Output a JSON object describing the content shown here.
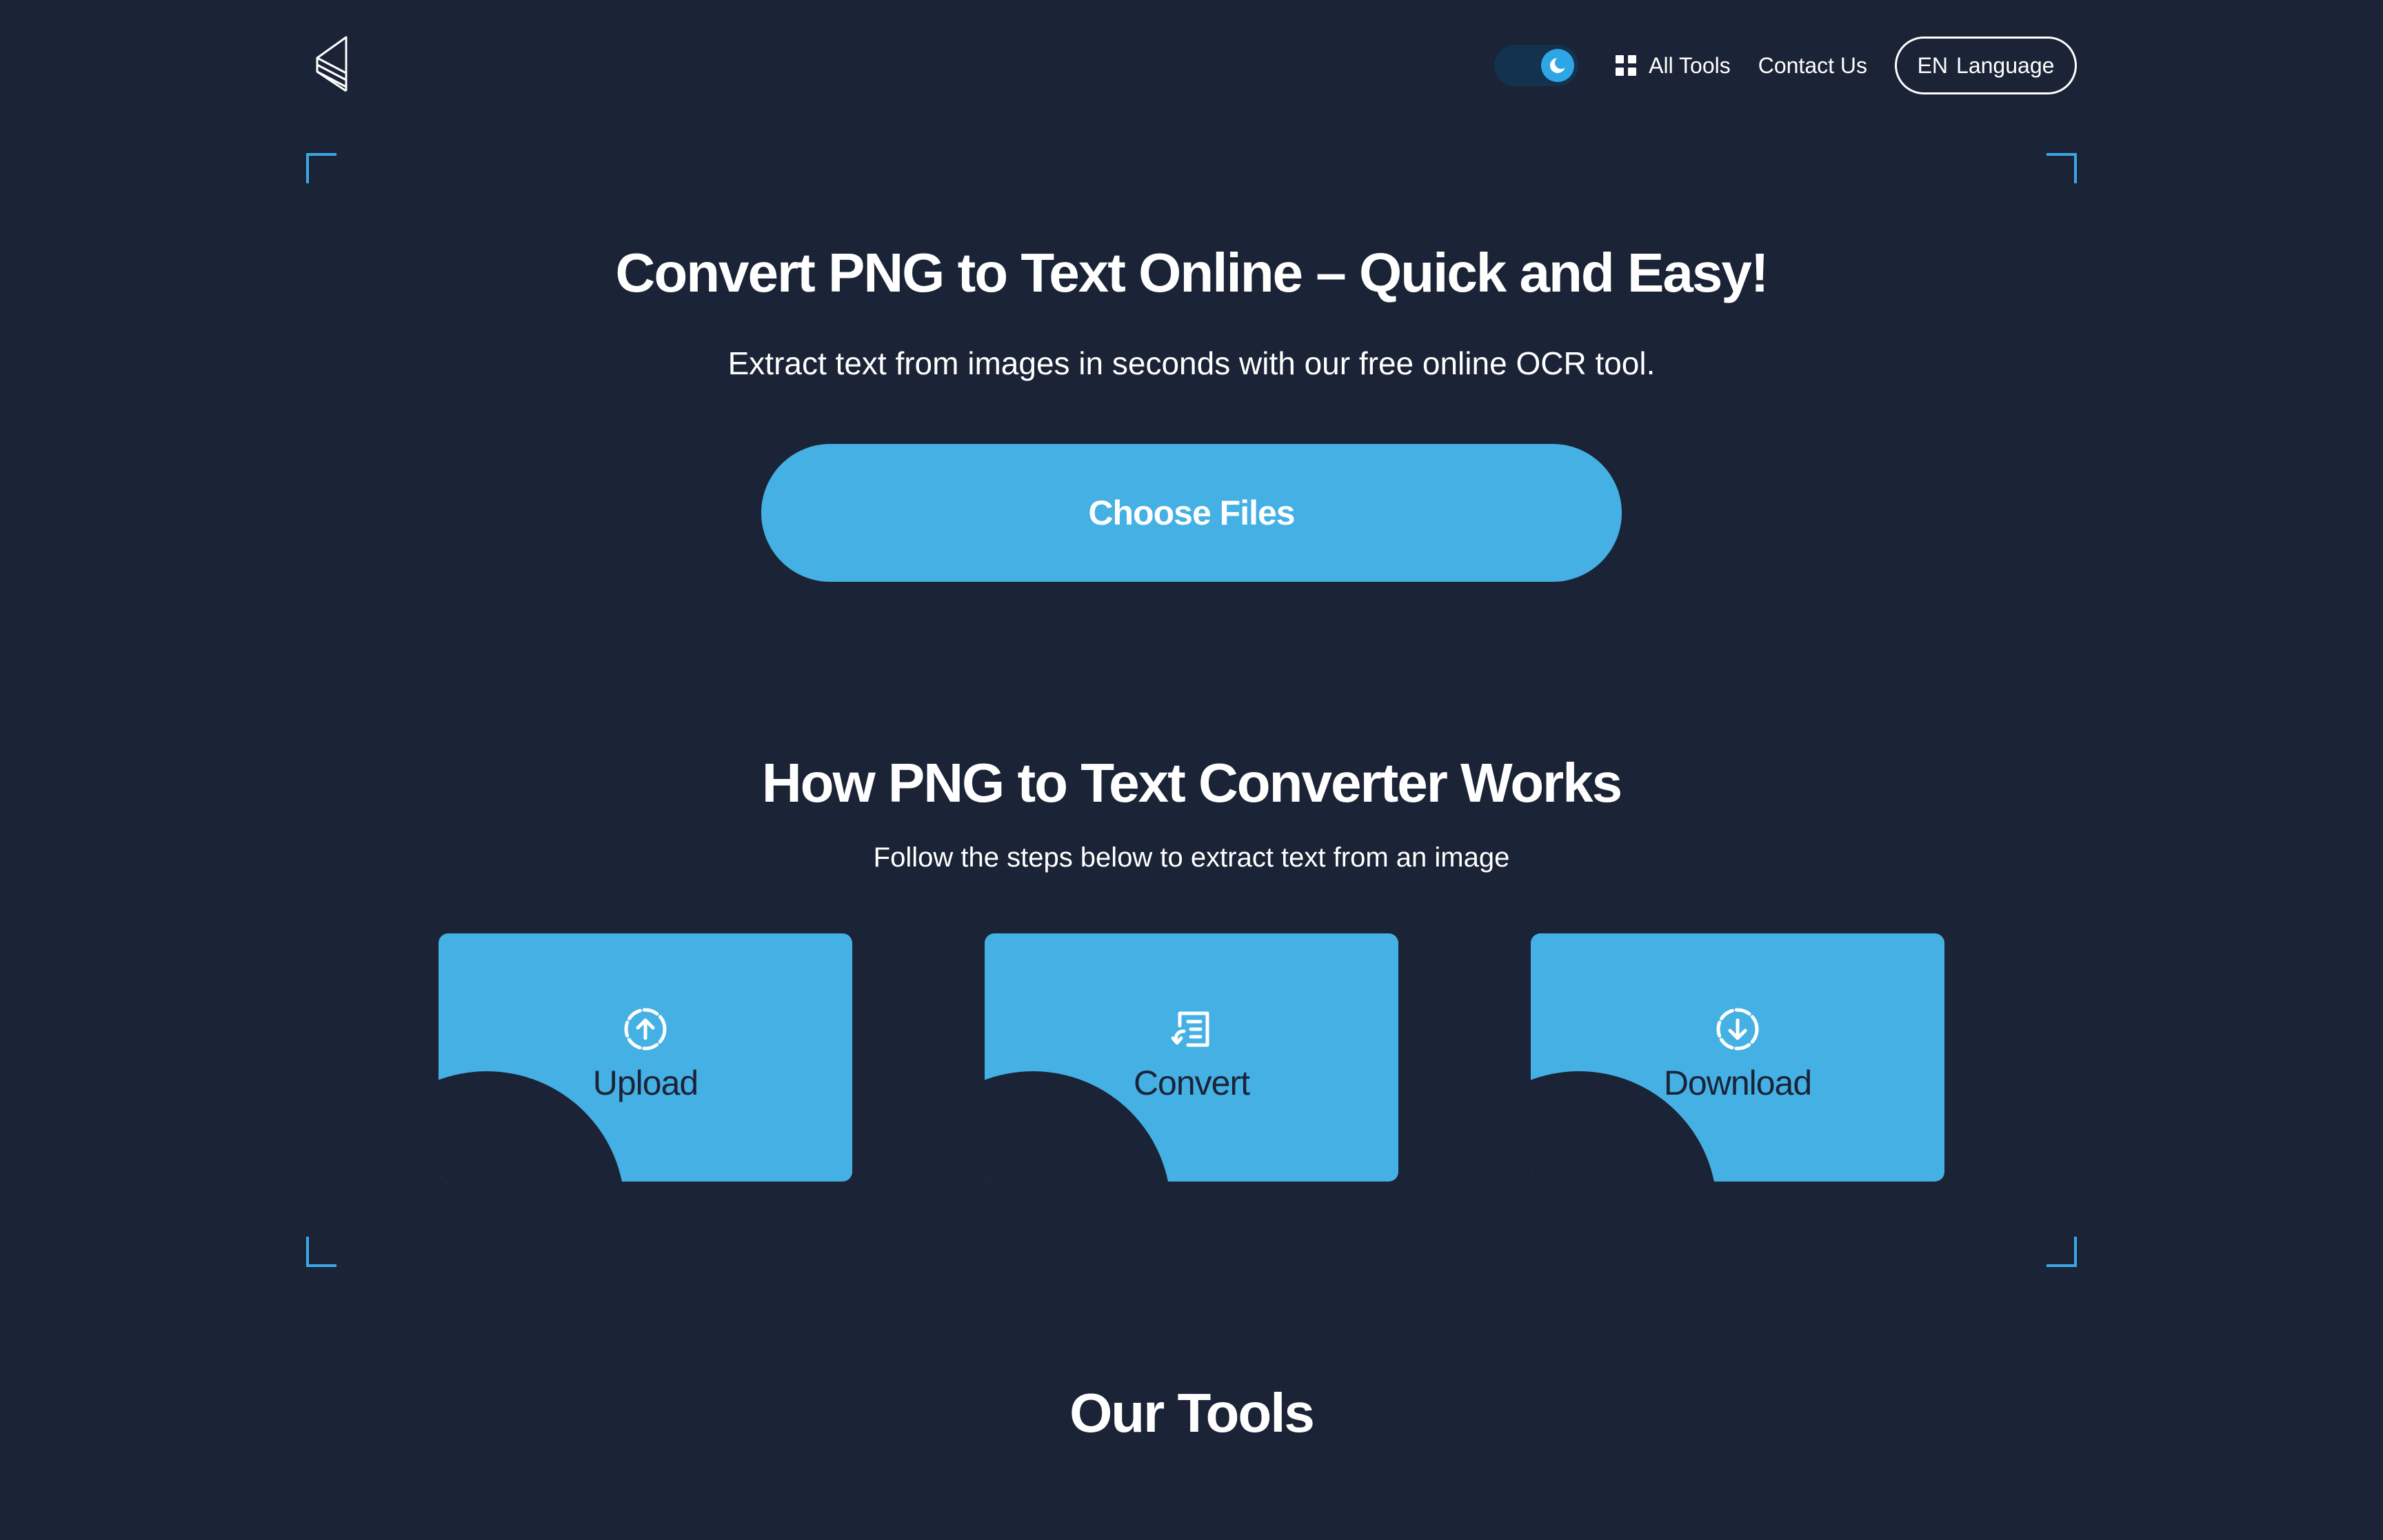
{
  "header": {
    "theme_toggle_state": "dark",
    "nav": {
      "all_tools": "All Tools",
      "contact_us": "Contact Us"
    },
    "language": {
      "code": "EN",
      "label": "Language"
    }
  },
  "hero": {
    "title": "Convert PNG to Text Online – Quick and Easy!",
    "subtitle": "Extract text from images in seconds with our free online OCR tool.",
    "choose_files_label": "Choose Files"
  },
  "how_it_works": {
    "title": "How PNG to Text Converter Works",
    "subtitle": "Follow the steps below to extract text from an image",
    "steps": [
      {
        "label": "Upload",
        "icon": "upload-icon"
      },
      {
        "label": "Convert",
        "icon": "convert-icon"
      },
      {
        "label": "Download",
        "icon": "download-icon"
      }
    ]
  },
  "tools": {
    "title": "Our Tools"
  },
  "colors": {
    "background": "#1b2336",
    "accent": "#44b0e4",
    "corner": "#3aa8e6"
  }
}
